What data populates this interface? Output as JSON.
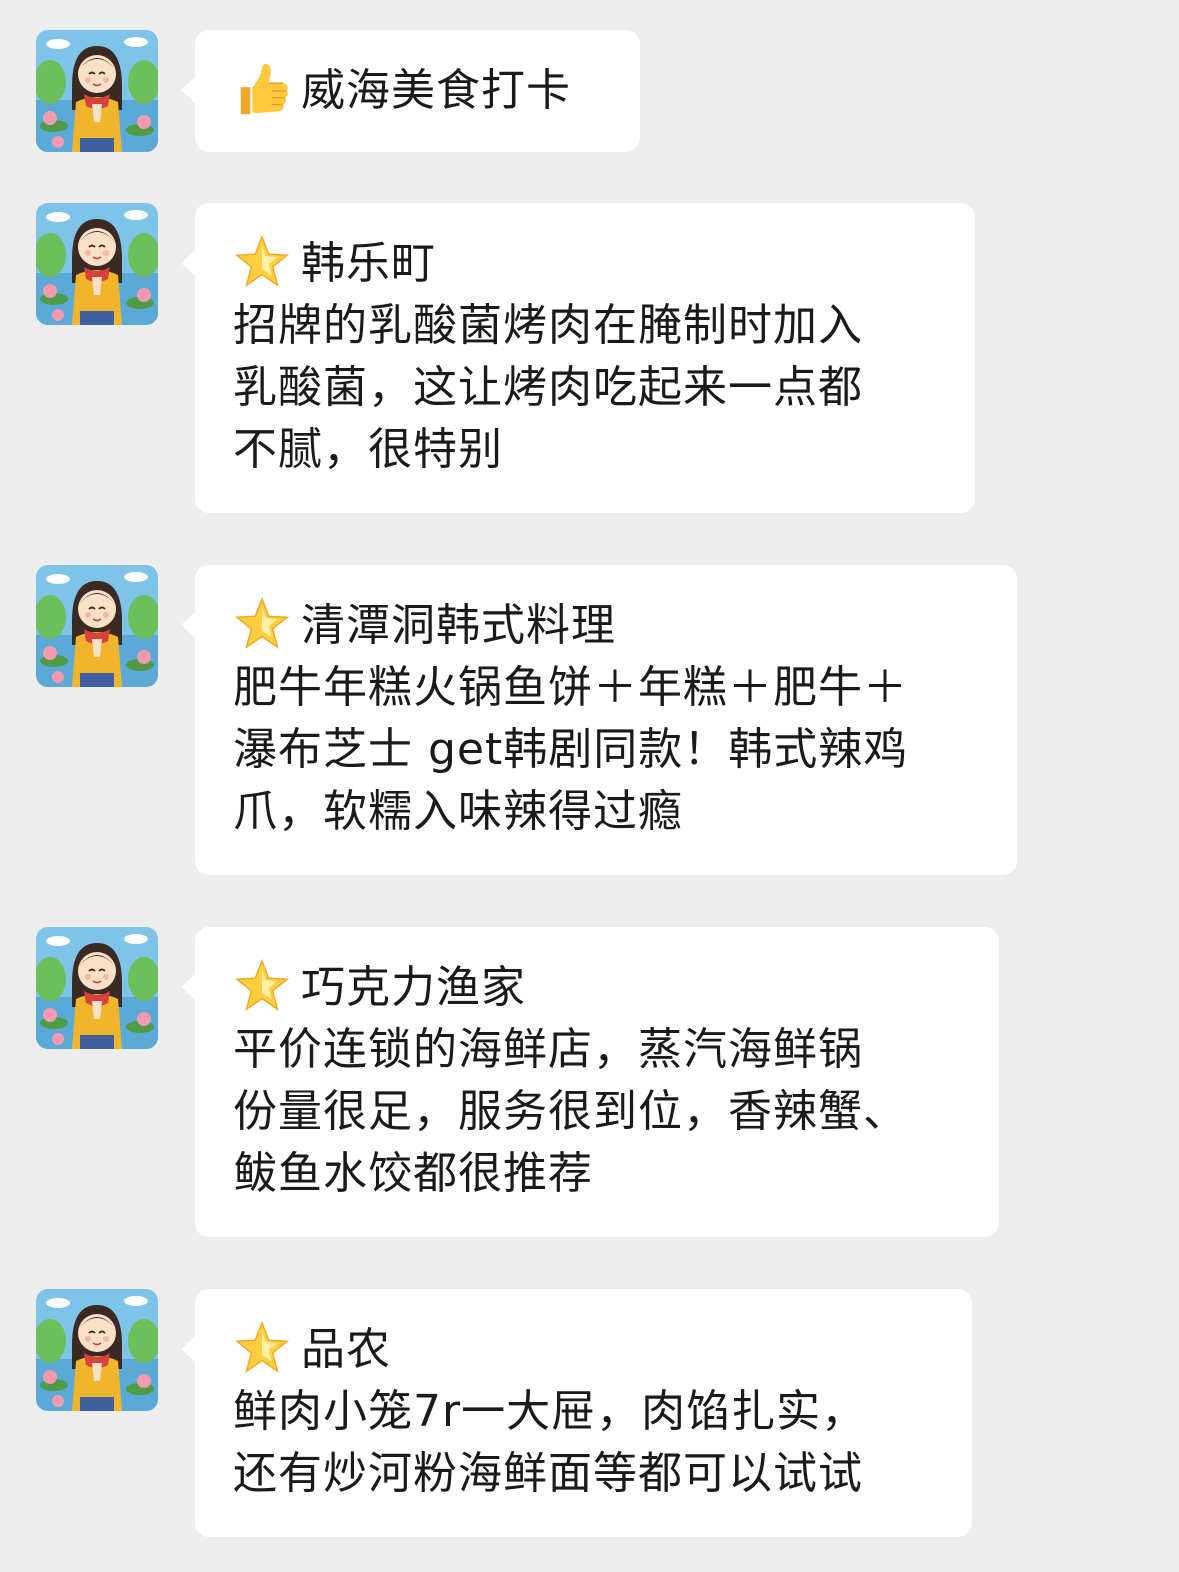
{
  "messages": [
    {
      "icon": "thumbs-up-icon",
      "title": "威海美食打卡",
      "lines": []
    },
    {
      "icon": "star-icon",
      "title": " 韩乐町",
      "lines": [
        "招牌的乳酸菌烤肉在腌制时加入",
        "乳酸菌，这让烤肉吃起来一点都",
        "不腻，很特别"
      ]
    },
    {
      "icon": "star-icon",
      "title": "清潭洞韩式料理",
      "lines": [
        "肥牛年糕火锅鱼饼＋年糕＋肥牛＋",
        "瀑布芝士 get韩剧同款！韩式辣鸡",
        "爪，软糯入味辣得过瘾"
      ]
    },
    {
      "icon": "star-icon",
      "title": "巧克力渔家",
      "lines": [
        "平价连锁的海鲜店，蒸汽海鲜锅",
        "份量很足，服务很到位，香辣蟹、",
        "鲅鱼水饺都很推荐"
      ]
    },
    {
      "icon": "star-icon",
      "title": "品农",
      "lines": [
        "鲜肉小笼7r一大屉，肉馅扎实，",
        "还有炒河粉海鲜面等都可以试试"
      ]
    }
  ],
  "colors": {
    "background": "#ededed",
    "bubble": "#ffffff",
    "text": "#1a1a1a"
  }
}
